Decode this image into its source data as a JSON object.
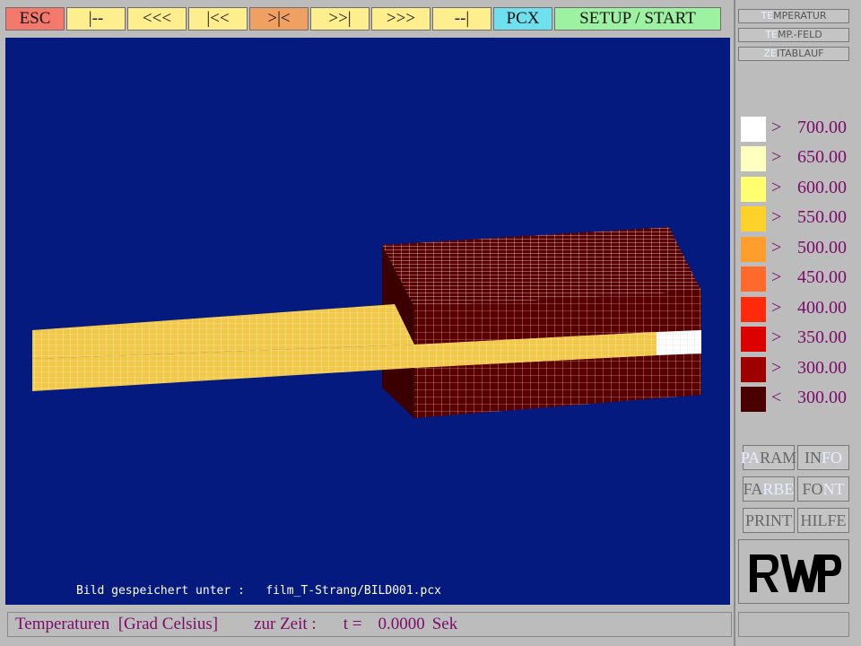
{
  "toolbar": {
    "buttons": [
      {
        "label": "ESC",
        "color": "#f4786c"
      },
      {
        "label": "|--",
        "color": "#ffee8e"
      },
      {
        "label": "<<<",
        "color": "#ffee8e"
      },
      {
        "label": "|<<",
        "color": "#ffee8e"
      },
      {
        "label": ">|<",
        "color": "#f0a060"
      },
      {
        "label": ">>|",
        "color": "#ffee8e"
      },
      {
        "label": ">>>",
        "color": "#ffee8e"
      },
      {
        "label": "--|",
        "color": "#ffee8e"
      },
      {
        "label": "PCX",
        "color": "#6ee0ee"
      },
      {
        "label": "SETUP / START",
        "color": "#9cf2a0"
      }
    ]
  },
  "menu": {
    "items": [
      {
        "first": "TE",
        "rest": "MPERATUR"
      },
      {
        "first": "TE",
        "rest": "MP.-FELD"
      },
      {
        "first": "ZE",
        "rest": "ITABLAUF"
      }
    ]
  },
  "legend": {
    "rows": [
      {
        "op": ">",
        "value": "700.00",
        "color": "#ffffff"
      },
      {
        "op": ">",
        "value": "650.00",
        "color": "#ffffc0"
      },
      {
        "op": ">",
        "value": "600.00",
        "color": "#ffff70"
      },
      {
        "op": ">",
        "value": "550.00",
        "color": "#ffd22a"
      },
      {
        "op": ">",
        "value": "500.00",
        "color": "#ff9e2c"
      },
      {
        "op": ">",
        "value": "450.00",
        "color": "#ff6a2c"
      },
      {
        "op": ">",
        "value": "400.00",
        "color": "#ff2a0c"
      },
      {
        "op": ">",
        "value": "350.00",
        "color": "#dd0000"
      },
      {
        "op": ">",
        "value": "300.00",
        "color": "#9e0000"
      },
      {
        "op": "<",
        "value": "300.00",
        "color": "#4a0000"
      }
    ]
  },
  "buttons": {
    "param": {
      "hl": "PA",
      "rest": "RAM"
    },
    "info": {
      "pre": "IN",
      "hl": "FO",
      "rest": ""
    },
    "farbe": {
      "pre": "FA",
      "hl": "RBE",
      "rest": ""
    },
    "font": {
      "pre": "FO",
      "hl": "NT",
      "rest": ""
    },
    "print": {
      "pre": "PRINT",
      "hl": "",
      "rest": ""
    },
    "hilfe": {
      "pre": "HILFE",
      "hl": "",
      "rest": ""
    }
  },
  "status": {
    "saved_message": "Bild gespeichert unter :   film_T-Strang/BILD001.pcx",
    "label": "Temperaturen  [Grad Celsius]",
    "time_label": "zur Zeit :",
    "t_label": "t =",
    "t_value": "0.0000",
    "t_unit": "Sek"
  },
  "logo": {
    "name": "rwp-logo"
  },
  "colors": {
    "viewport_bg": "#041a7e",
    "strand": "#f2c84a",
    "block": "#5a0000",
    "text_accent": "#7b0b6b"
  }
}
